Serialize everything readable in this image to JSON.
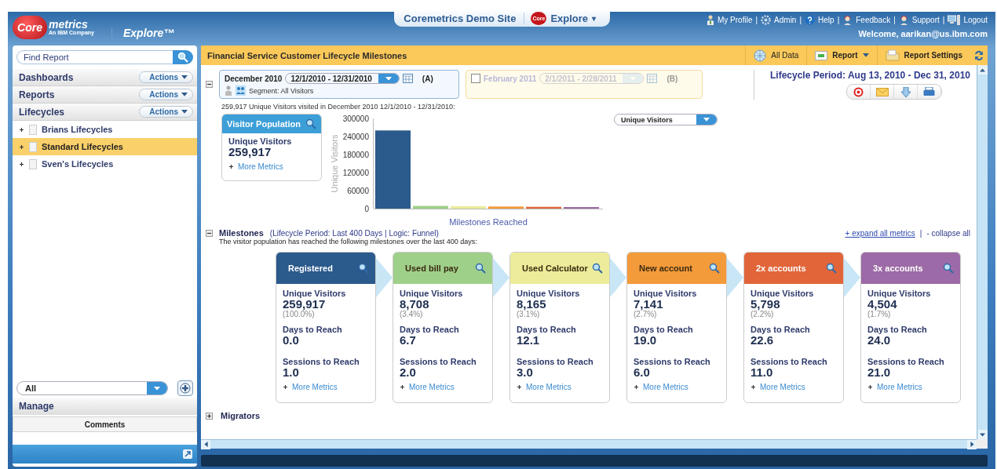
{
  "header": {
    "logo": {
      "word1": "Core",
      "word2": "metrics",
      "tagline": "An IBM Company"
    },
    "product": "Explore™",
    "site_tab": "Coremetrics Demo Site",
    "app_menu": {
      "badge": "Core",
      "label": "Explore",
      "caret": "▾"
    },
    "links": [
      {
        "label": "My Profile",
        "kind": "person"
      },
      {
        "label": "Admin",
        "kind": "gear"
      },
      {
        "label": "Help",
        "kind": "help"
      },
      {
        "label": "Feedback",
        "kind": "headset"
      },
      {
        "label": "Support",
        "kind": "headset"
      },
      {
        "label": "Logout",
        "kind": "monitor"
      }
    ],
    "separators": [
      "|",
      "|",
      "|",
      "|",
      "|"
    ],
    "welcome": "Welcome, aarikan@us.ibm.com"
  },
  "sidebar": {
    "search": {
      "placeholder": "Find Report"
    },
    "sections": [
      {
        "label": "Dashboards",
        "action": "Actions"
      },
      {
        "label": "Reports",
        "action": "Actions"
      },
      {
        "label": "Lifecycles",
        "action": "Actions"
      }
    ],
    "tree": [
      {
        "label": "Brians Lifecycles",
        "selected": false
      },
      {
        "label": "Standard Lifecycles",
        "selected": true
      },
      {
        "label": "Sven's Lifecycles",
        "selected": false
      }
    ],
    "filter": {
      "value": "All"
    },
    "manage": "Manage",
    "comments": "Comments"
  },
  "report": {
    "title": "Financial Service Customer Lifecycle Milestones",
    "toolbar": [
      {
        "label": "All Data",
        "kind": "globe"
      },
      {
        "label": "Report",
        "kind": "menu"
      },
      {
        "label": "Report Settings",
        "kind": "folder"
      }
    ],
    "period_a": {
      "month": "December 2010",
      "range": "12/1/2010 - 12/31/2010",
      "tag": "(A)",
      "segment": "Segment:  All Visitors"
    },
    "period_b": {
      "checked": false,
      "month": "February 2011",
      "range": "2/1/2011 - 2/28/2011",
      "tag": "(B)"
    },
    "lifecycle_period": "Lifecycle Period: Aug 13, 2010 - Dec 31, 2010",
    "summary": "259,917 Unique Visitors visited in December 2010 12/1/2010 - 12/31/2010:",
    "population": {
      "title": "Visitor Population",
      "metric": "Unique Visitors",
      "value": "259,917",
      "more": "More Metrics"
    },
    "metric_select": "Unique Visitors",
    "chart_data": {
      "type": "bar",
      "xlabel": "Milestones Reached",
      "ylabel": "Unique Visitors",
      "ylim": [
        0,
        300000
      ],
      "categories": [
        null,
        null,
        null,
        null,
        null,
        null
      ],
      "yticks": [
        {
          "value": 0,
          "label": "0"
        },
        {
          "value": 60000,
          "label": "60000"
        },
        {
          "value": 120000,
          "label": "120000"
        },
        {
          "value": 180000,
          "label": "180000"
        },
        {
          "value": 240000,
          "label": "240000"
        },
        {
          "value": 300000,
          "label": "300000"
        }
      ],
      "values": [
        260000,
        9000,
        8000,
        7000,
        6000,
        5000
      ]
    },
    "milestones": {
      "title": "Milestones",
      "expanded": true,
      "meta": "(Lifecycle Period: Last 400 Days  |  Logic: Funnel)",
      "description": "The visitor population has reached the following milestones over the last 400 days:",
      "expand_all": "+ expand all metrics",
      "separator": "|",
      "collapse_all": "- collapse all",
      "items": [
        {
          "name": "Registered",
          "color": "#2b5a8c",
          "visitors_label": "Unique Visitors",
          "visitors": "259,917",
          "share": "(100.0%)",
          "days_label": "Days to Reach",
          "days": "0.0",
          "sessions_label": "Sessions to Reach",
          "sessions": "1.0",
          "more": "More Metrics"
        },
        {
          "name": "Used bill pay",
          "color": "#9fd08a",
          "visitors_label": "Unique Visitors",
          "visitors": "8,708",
          "share": "(3.4%)",
          "days_label": "Days to Reach",
          "days": "6.7",
          "sessions_label": "Sessions to Reach",
          "sessions": "2.0",
          "more": "More Metrics"
        },
        {
          "name": "Used Calculator",
          "color": "#ecec9a",
          "visitors_label": "Unique Visitors",
          "visitors": "8,165",
          "share": "(3.1%)",
          "days_label": "Days to Reach",
          "days": "12.1",
          "sessions_label": "Sessions to Reach",
          "sessions": "3.0",
          "more": "More Metrics"
        },
        {
          "name": "New account",
          "color": "#f39a3a",
          "visitors_label": "Unique Visitors",
          "visitors": "7,141",
          "share": "(2.7%)",
          "days_label": "Days to Reach",
          "days": "19.0",
          "sessions_label": "Sessions to Reach",
          "sessions": "6.0",
          "more": "More Metrics"
        },
        {
          "name": "2x accounts",
          "color": "#e2653a",
          "visitors_label": "Unique Visitors",
          "visitors": "5,798",
          "share": "(2.2%)",
          "days_label": "Days to Reach",
          "days": "22.6",
          "sessions_label": "Sessions to Reach",
          "sessions": "11.0",
          "more": "More Metrics"
        },
        {
          "name": "3x accounts",
          "color": "#9c6aa6",
          "visitors_label": "Unique Visitors",
          "visitors": "4,504",
          "share": "(1.7%)",
          "days_label": "Days to Reach",
          "days": "24.0",
          "sessions_label": "Sessions to Reach",
          "sessions": "21.0",
          "more": "More Metrics"
        }
      ]
    },
    "migrators": {
      "title": "Migrators",
      "expanded": false
    }
  }
}
